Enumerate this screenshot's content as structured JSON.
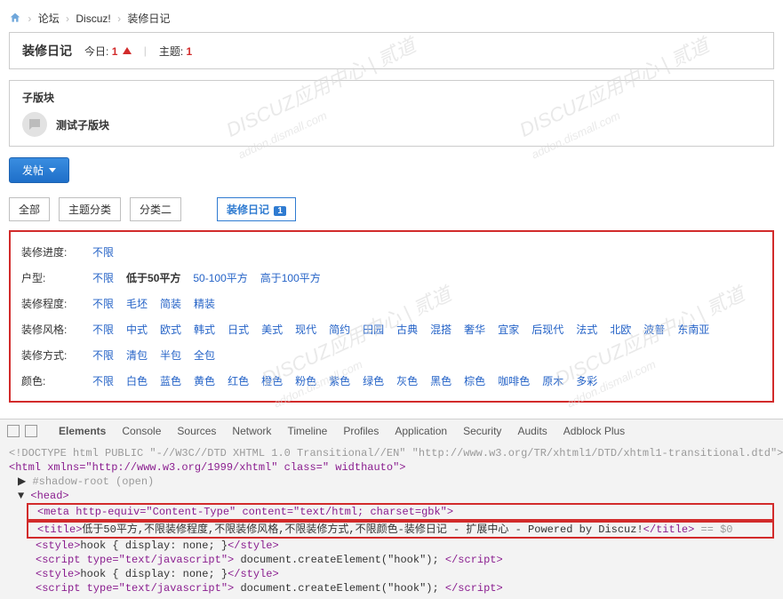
{
  "breadcrumb": {
    "forum": "论坛",
    "discuz": "Discuz!",
    "current": "装修日记"
  },
  "header": {
    "title": "装修日记",
    "today_lbl": "今日:",
    "today_count": "1",
    "topics_lbl": "主题:",
    "topics_count": "1"
  },
  "sub": {
    "head": "子版块",
    "name": "测试子版块"
  },
  "post_btn": "发帖",
  "tabs": {
    "all": "全部",
    "cat": "主题分类",
    "cat2": "分类二",
    "active": "装修日记",
    "badge": "1"
  },
  "filters": [
    {
      "label": "装修进度:",
      "opts": [
        "不限"
      ]
    },
    {
      "label": "户型:",
      "opts": [
        "不限",
        "低于50平方",
        "50-100平方",
        "高于100平方"
      ],
      "bold": 1
    },
    {
      "label": "装修程度:",
      "opts": [
        "不限",
        "毛坯",
        "简装",
        "精装"
      ]
    },
    {
      "label": "装修风格:",
      "opts": [
        "不限",
        "中式",
        "欧式",
        "韩式",
        "日式",
        "美式",
        "现代",
        "简约",
        "田园",
        "古典",
        "混搭",
        "奢华",
        "宜家",
        "后现代",
        "法式",
        "北欧",
        "波普",
        "东南亚"
      ]
    },
    {
      "label": "装修方式:",
      "opts": [
        "不限",
        "清包",
        "半包",
        "全包"
      ]
    },
    {
      "label": "颜色:",
      "opts": [
        "不限",
        "白色",
        "蓝色",
        "黄色",
        "红色",
        "橙色",
        "粉色",
        "紫色",
        "绿色",
        "灰色",
        "黑色",
        "棕色",
        "咖啡色",
        "原木",
        "多彩"
      ]
    }
  ],
  "dev": {
    "tabs": [
      "Elements",
      "Console",
      "Sources",
      "Network",
      "Timeline",
      "Profiles",
      "Application",
      "Security",
      "Audits",
      "Adblock Plus"
    ],
    "doctype": "<!DOCTYPE html PUBLIC \"-//W3C//DTD XHTML 1.0 Transitional//EN\" \"http://www.w3.org/TR/xhtml1/DTD/xhtml1-transitional.dtd\">",
    "html_open": "<html xmlns=\"http://www.w3.org/1999/xhtml\" class=\" widthauto\">",
    "shadow": "#shadow-root (open)",
    "head": "<head>",
    "meta": "<meta http-equiv=\"Content-Type\" content=\"text/html; charset=gbk\">",
    "title_open": "<title>",
    "title_text": "低于50平方,不限装修程度,不限装修风格,不限装修方式,不限颜色-装修日记 -  扩展中心 -  Powered by Discuz!",
    "title_close": "</title>",
    "eq0": " == $0",
    "style1": "<style>hook { display: none; }</style>",
    "script1_open": "<script type=\"text/javascript\">",
    "script1_body": " document.createElement(\"hook\"); ",
    "script1_close": "</script>",
    "style2": "<style>hook { display: none; }</style>",
    "script2_open": "<script type=\"text/javascript\">",
    "script2_body": " document.createElement(\"hook\"); ",
    "script2_close": "</script>"
  },
  "watermarks": {
    "w1": "DISCUZ应用中心",
    "w2": "addon.dismall.com"
  }
}
